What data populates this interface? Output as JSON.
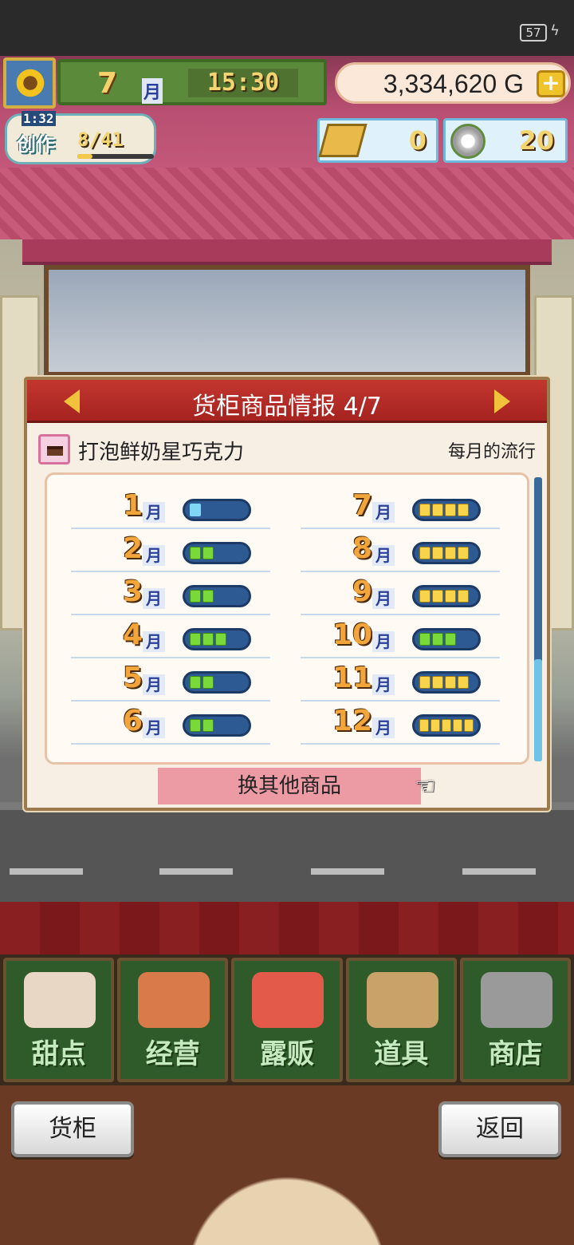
{
  "status": {
    "battery": "57"
  },
  "hud": {
    "month_number": "7",
    "month_label": "月",
    "time": "15:30",
    "gold": "3,334,620 G",
    "create": {
      "timer": "1:32",
      "label": "创作",
      "count": "8/41",
      "progress": 0.2
    },
    "tickets": "0",
    "medals": "20"
  },
  "dialog": {
    "title": "货柜商品情报 4/7",
    "item_name": "打泡鲜奶星巧克力",
    "trend_label": "每月的流行",
    "months": [
      {
        "num": "1",
        "label": "月",
        "level": 1,
        "color": "blue"
      },
      {
        "num": "2",
        "label": "月",
        "level": 2,
        "color": "green"
      },
      {
        "num": "3",
        "label": "月",
        "level": 2,
        "color": "green"
      },
      {
        "num": "4",
        "label": "月",
        "level": 3,
        "color": "green"
      },
      {
        "num": "5",
        "label": "月",
        "level": 2,
        "color": "green"
      },
      {
        "num": "6",
        "label": "月",
        "level": 2,
        "color": "green"
      },
      {
        "num": "7",
        "label": "月",
        "level": 4,
        "color": "yellow"
      },
      {
        "num": "8",
        "label": "月",
        "level": 4,
        "color": "yellow"
      },
      {
        "num": "9",
        "label": "月",
        "level": 4,
        "color": "yellow"
      },
      {
        "num": "10",
        "label": "月",
        "level": 3,
        "color": "green"
      },
      {
        "num": "11",
        "label": "月",
        "level": 4,
        "color": "yellow"
      },
      {
        "num": "12",
        "label": "月",
        "level": 5,
        "color": "yellow"
      }
    ],
    "other_button": "换其他商品"
  },
  "nav": [
    {
      "label": "甜点",
      "icon": "cake-icon",
      "color": "#e9d7c6"
    },
    {
      "label": "经营",
      "icon": "shop-icon",
      "color": "#d97a4a"
    },
    {
      "label": "露贩",
      "icon": "truck-icon",
      "color": "#e35a4a"
    },
    {
      "label": "道具",
      "icon": "gear-bag-icon",
      "color": "#c9a26a"
    },
    {
      "label": "商店",
      "icon": "cart-icon",
      "color": "#9a9a9a"
    }
  ],
  "footer": {
    "left_button": "货柜",
    "right_button": "返回"
  }
}
